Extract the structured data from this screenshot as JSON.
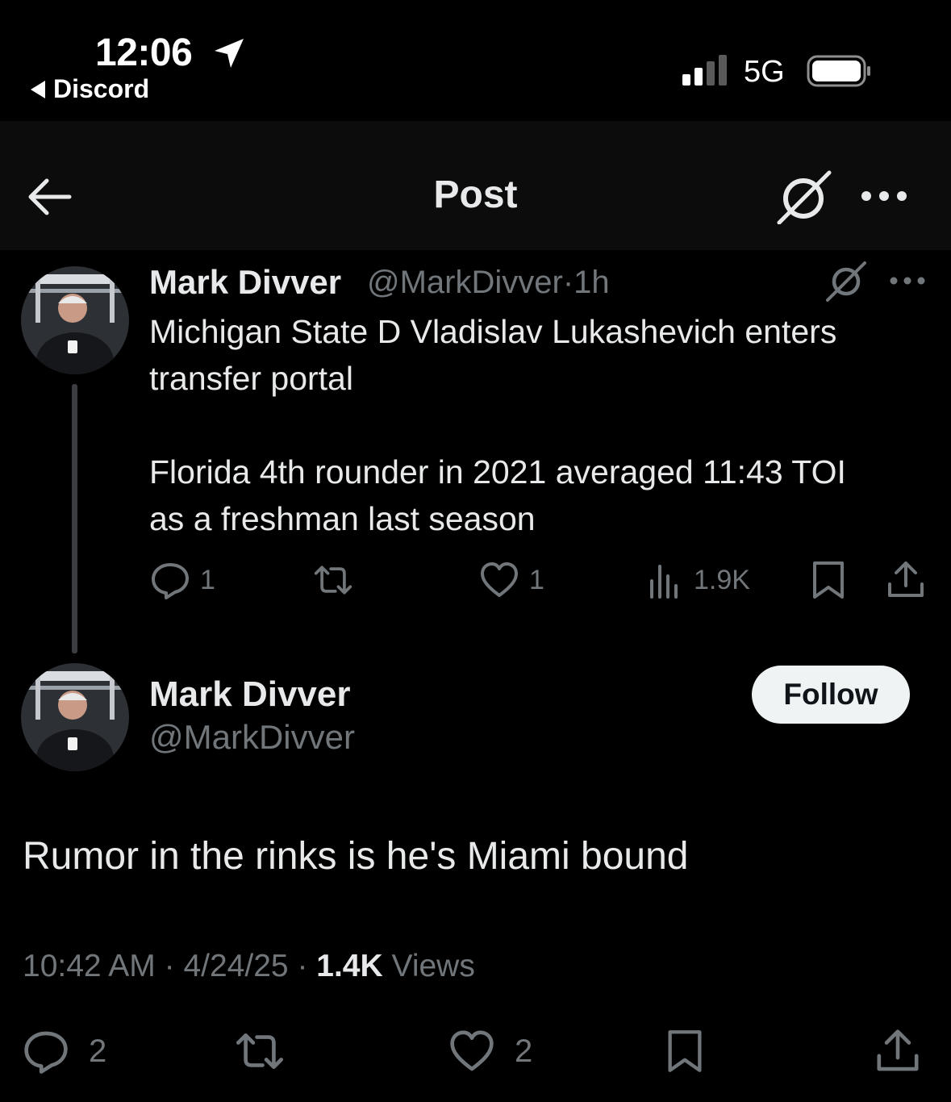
{
  "status_bar": {
    "time": "12:06",
    "back_app": "Discord",
    "network": "5G"
  },
  "header": {
    "title": "Post",
    "icons": [
      "back-arrow-icon",
      "grok-icon",
      "more-icon"
    ]
  },
  "tweet1": {
    "name": "Mark Divver",
    "handle": "@MarkDivver",
    "separator": "·",
    "time": "1h",
    "text_line1": "Michigan State D Vladislav Lukashevich enters",
    "text_line2": "transfer portal",
    "text_line3": "Florida 4th rounder in 2021 averaged 11:43 TOI",
    "text_line4": "as a freshman last season",
    "replies": "1",
    "reposts": "",
    "likes": "1",
    "views": "1.9K"
  },
  "tweet2": {
    "name": "Mark Divver",
    "handle": "@MarkDivver",
    "follow_label": "Follow",
    "text": "Rumor in the rinks is he's Miami bound",
    "time": "10:42 AM",
    "date": "4/24/25",
    "views_count": "1.4K",
    "views_label": "Views",
    "separator": "·",
    "replies": "2",
    "reposts": "",
    "likes": "2"
  },
  "colors": {
    "background": "#000000",
    "text": "#e7e9ea",
    "muted": "#71767b",
    "follow_bg": "#eff3f4"
  }
}
